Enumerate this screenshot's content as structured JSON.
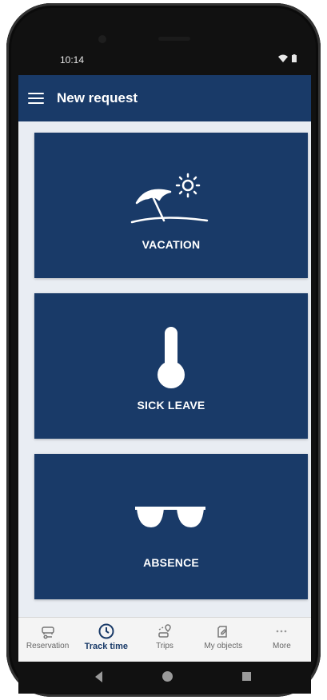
{
  "status_bar": {
    "time": "10:14",
    "icons": "wifi-icon, battery-icon"
  },
  "app_bar": {
    "title": "New request",
    "menu_icon": "hamburger-menu-icon"
  },
  "tiles": [
    {
      "label": "VACATION",
      "icon": "beach-umbrella-sun-icon"
    },
    {
      "label": "SICK LEAVE",
      "icon": "thermometer-icon"
    },
    {
      "label": "ABSENCE",
      "icon": "sunglasses-icon"
    }
  ],
  "bottom_nav": {
    "items": [
      {
        "label": "Reservation",
        "icon": "car-key-icon",
        "active": false
      },
      {
        "label": "Track time",
        "icon": "clock-icon",
        "active": true
      },
      {
        "label": "Trips",
        "icon": "car-route-icon",
        "active": false
      },
      {
        "label": "My objects",
        "icon": "edit-document-icon",
        "active": false
      },
      {
        "label": "More",
        "icon": "ellipsis-icon",
        "active": false
      }
    ]
  },
  "colors": {
    "primary": "#193a68",
    "background": "#e9edf3",
    "nav_background": "#f4f4f4"
  }
}
